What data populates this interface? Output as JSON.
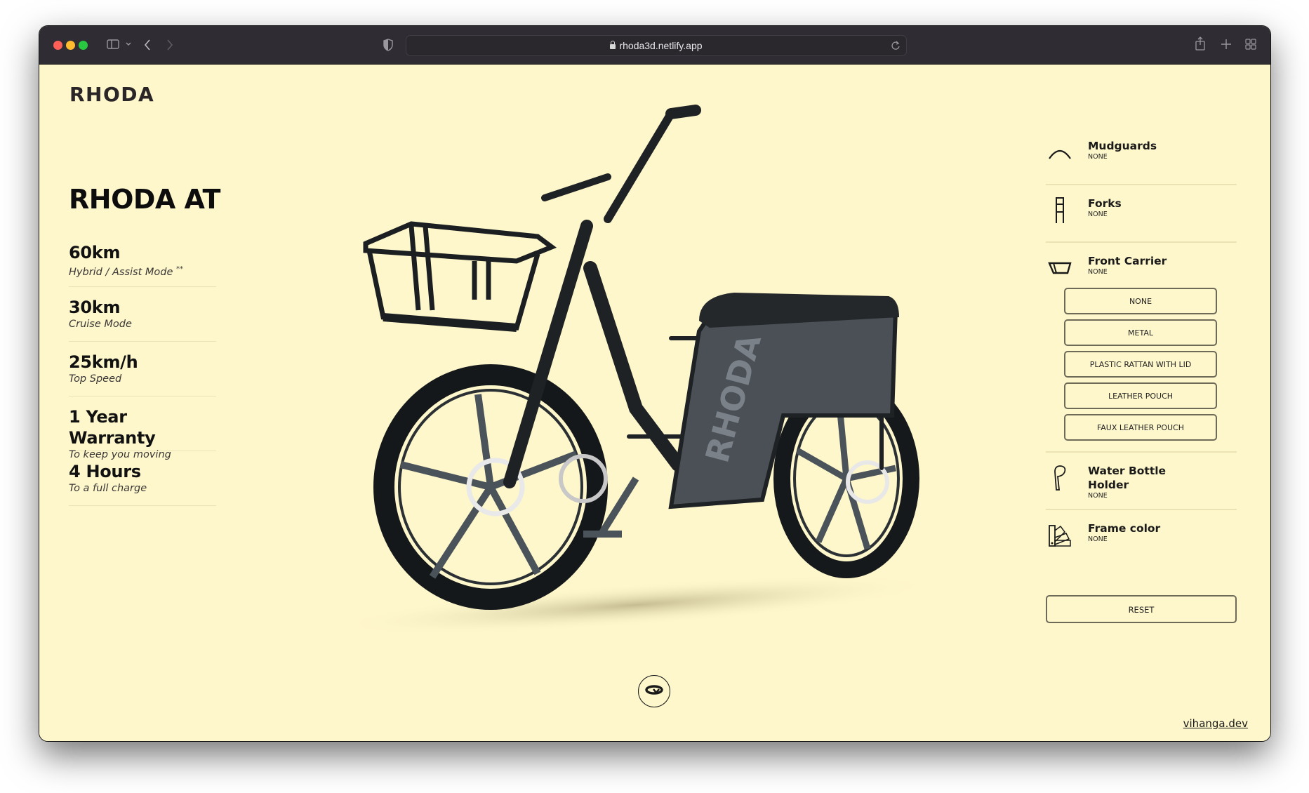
{
  "browser": {
    "url": "rhoda3d.netlify.app",
    "icons": [
      "sidebar-icon",
      "chevron-down-icon",
      "back-icon",
      "forward-icon",
      "shield-icon",
      "lock-icon",
      "reload-icon",
      "share-icon",
      "new-tab-icon",
      "tab-overview-icon"
    ]
  },
  "page": {
    "logo": "RHODA",
    "model_title": "RHODA AT",
    "specs": [
      {
        "value": "60km",
        "label": "Hybrid / Assist Mode",
        "note": "**"
      },
      {
        "value": "30km",
        "label": "Cruise Mode",
        "note": ""
      },
      {
        "value": "25km/h",
        "label": "Top Speed",
        "note": ""
      },
      {
        "value": "1 Year Warranty",
        "label": "To keep you moving",
        "note": ""
      },
      {
        "value": "4 Hours",
        "label": "To a full charge",
        "note": ""
      }
    ],
    "bike_brand_text": "RHODA",
    "options": [
      {
        "name": "Mudguards",
        "value": "NONE",
        "icon": "mudguard-icon"
      },
      {
        "name": "Forks",
        "value": "NONE",
        "icon": "fork-icon"
      },
      {
        "name": "Front Carrier",
        "value": "NONE",
        "icon": "basket-icon",
        "choices": [
          "NONE",
          "METAL",
          "PLASTIC RATTAN WITH LID",
          "LEATHER POUCH",
          "FAUX LEATHER POUCH"
        ]
      },
      {
        "name": "Water Bottle Holder",
        "value": "NONE",
        "icon": "bottle-holder-icon"
      },
      {
        "name": "Frame color",
        "value": "NONE",
        "icon": "color-swatch-icon"
      }
    ],
    "reset_label": "RESET",
    "rotate_icon": "rotate-icon",
    "credit_link": "vihanga.dev"
  },
  "colors": {
    "background": "#fef7cb",
    "text": "#111111",
    "bike_frame": "#1f2224",
    "bike_panel": "#4a5056",
    "titlebar": "#2f2d33"
  }
}
